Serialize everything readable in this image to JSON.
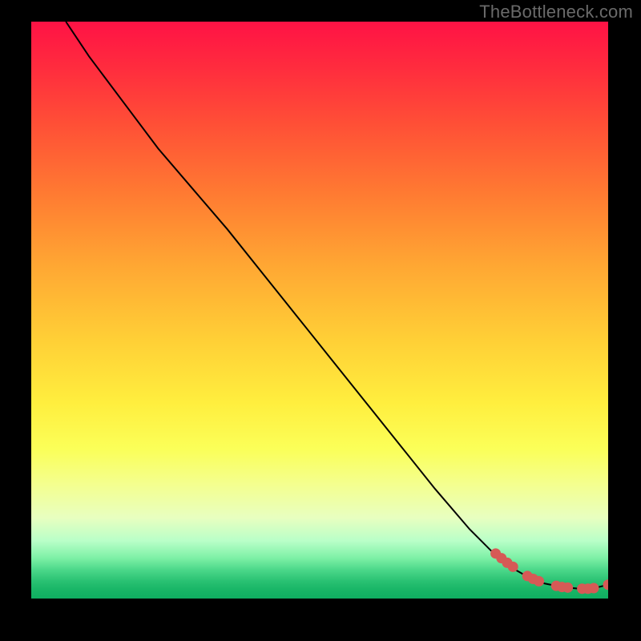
{
  "attribution": "TheBottleneck.com",
  "colors": {
    "background": "#000000",
    "curve": "#000000",
    "marker": "#d65a56",
    "attribution_text": "#6a6a6a"
  },
  "chart_data": {
    "type": "line",
    "title": "",
    "xlabel": "",
    "ylabel": "",
    "xlim": [
      0,
      100
    ],
    "ylim": [
      0,
      100
    ],
    "grid": false,
    "legend": false,
    "background_gradient": {
      "orientation": "vertical",
      "stops": [
        {
          "pos": 0.0,
          "color": "#ff1245"
        },
        {
          "pos": 0.5,
          "color": "#ffd634"
        },
        {
          "pos": 0.78,
          "color": "#f9ff6a"
        },
        {
          "pos": 1.0,
          "color": "#0fae61"
        }
      ]
    },
    "series": [
      {
        "name": "bottleneck-curve",
        "x": [
          6,
          10,
          16,
          22,
          28,
          34,
          40,
          46,
          52,
          58,
          64,
          70,
          76,
          80,
          83,
          86,
          89,
          92,
          95,
          98,
          100
        ],
        "y": [
          100,
          94,
          86,
          78,
          71,
          64,
          56.5,
          49,
          41.5,
          34,
          26.5,
          19,
          12,
          8,
          5.5,
          3.8,
          2.6,
          2.0,
          1.7,
          1.9,
          2.4
        ]
      }
    ],
    "markers": {
      "name": "highlighted-points",
      "type": "scatter",
      "color": "#d65a56",
      "x": [
        80.5,
        81.5,
        82.5,
        83.5,
        86.0,
        87.0,
        88.0,
        91.0,
        92.0,
        93.0,
        95.5,
        96.5,
        97.5,
        100.0
      ],
      "y": [
        7.8,
        7.0,
        6.2,
        5.5,
        3.9,
        3.4,
        3.0,
        2.2,
        2.0,
        1.9,
        1.7,
        1.7,
        1.8,
        2.4
      ]
    }
  }
}
